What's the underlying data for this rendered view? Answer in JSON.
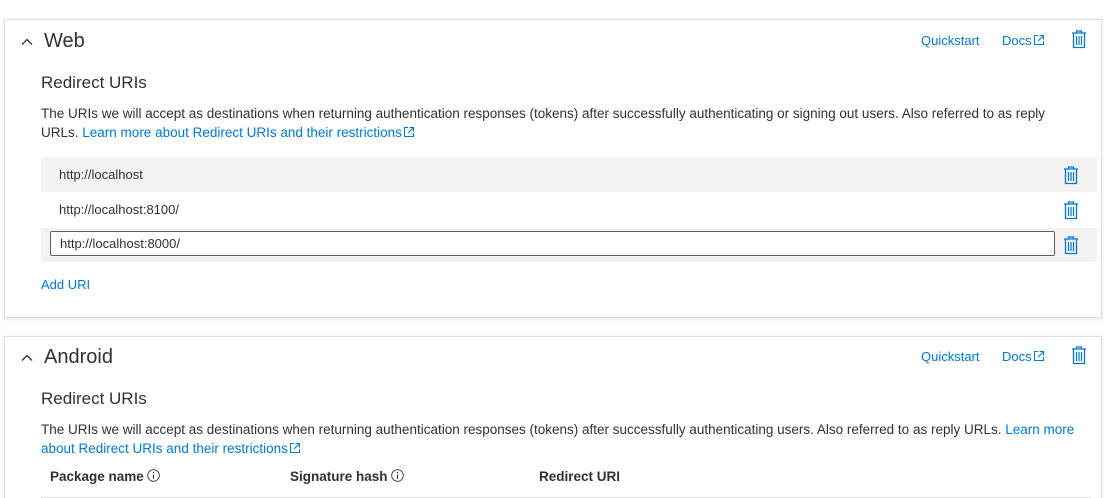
{
  "web": {
    "title": "Web",
    "quickstart_label": "Quickstart",
    "docs_label": "Docs",
    "redirect_title": "Redirect URIs",
    "description": "The URIs we will accept as destinations when returning authentication responses (tokens) after successfully authenticating or signing out users. Also referred to as reply URLs.",
    "learn_more": "Learn more about Redirect URIs and their restrictions",
    "uris": [
      "http://localhost",
      "http://localhost:8100/",
      "http://localhost:8000/"
    ],
    "add_uri_label": "Add URI"
  },
  "android": {
    "title": "Android",
    "quickstart_label": "Quickstart",
    "docs_label": "Docs",
    "redirect_title": "Redirect URIs",
    "description": "The URIs we will accept as destinations when returning authentication responses (tokens) after successfully authenticating users. Also referred to as reply URLs.",
    "learn_more": "Learn more about Redirect URIs and their restrictions",
    "columns": [
      "Package name",
      "Signature hash",
      "Redirect URI"
    ]
  },
  "colors": {
    "link": "#0078d4",
    "text": "#323130",
    "row_shade": "#f3f2f1",
    "border": "#e1dfdd"
  },
  "icons": {
    "collapse": "chevron-up-icon",
    "delete": "trash-icon",
    "external": "external-link-icon",
    "info": "info-icon"
  }
}
